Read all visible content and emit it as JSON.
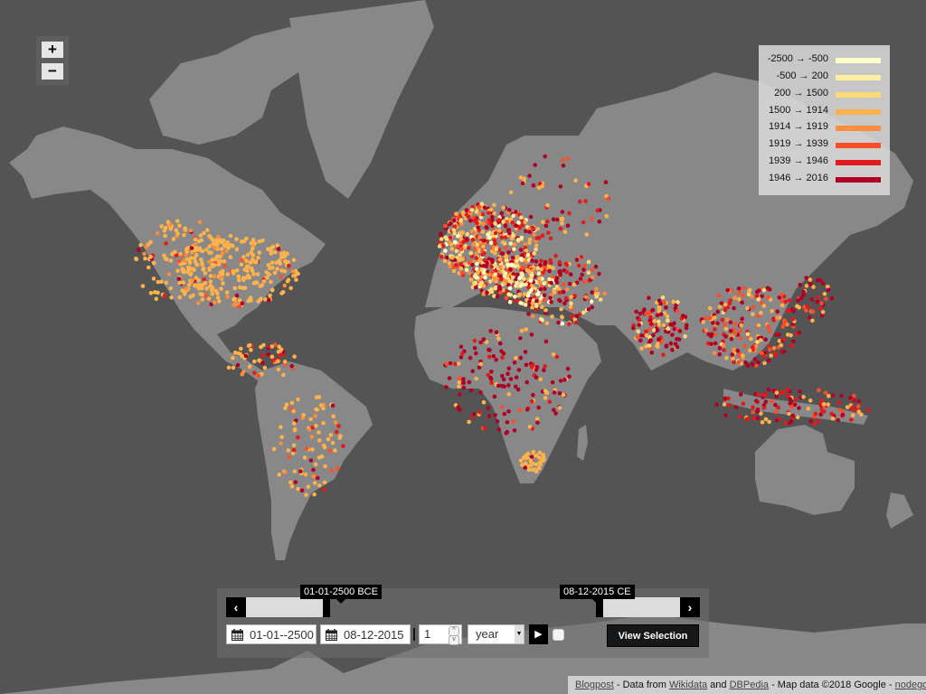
{
  "map": {
    "ocean_color": "#545454",
    "land_color": "#888888",
    "zoom_in_label": "+",
    "zoom_out_label": "−"
  },
  "legend": {
    "items": [
      {
        "label": "-2500 → -500",
        "color": "#ffffcc"
      },
      {
        "label": "-500 → 200",
        "color": "#ffeda0"
      },
      {
        "label": "200 → 1500",
        "color": "#fed976"
      },
      {
        "label": "1500 → 1914",
        "color": "#feb24c"
      },
      {
        "label": "1914 → 1919",
        "color": "#fd8d3c"
      },
      {
        "label": "1919 → 1939",
        "color": "#fc4e2a"
      },
      {
        "label": "1939 → 1946",
        "color": "#e31a1c"
      },
      {
        "label": "1946 → 2016",
        "color": "#b10026"
      }
    ]
  },
  "timeline": {
    "start_tooltip": "01-01-2500 BCE",
    "end_tooltip": "08-12-2015 CE",
    "prev_label": "‹",
    "next_label": "›",
    "start_date": "01-01--2500",
    "end_date": "08-12-2015",
    "step_value": "1",
    "step_unit": "year",
    "play_label": "▶",
    "view_selection_label": "View Selection"
  },
  "attribution": {
    "blogpost": "Blogpost",
    "text1": " - Data from ",
    "wikidata": "Wikidata",
    "text2": " and ",
    "dbpedia": "DBPedia",
    "text3": " - Map data ©2018 Google - ",
    "nodegoat": "nodegoat"
  }
}
